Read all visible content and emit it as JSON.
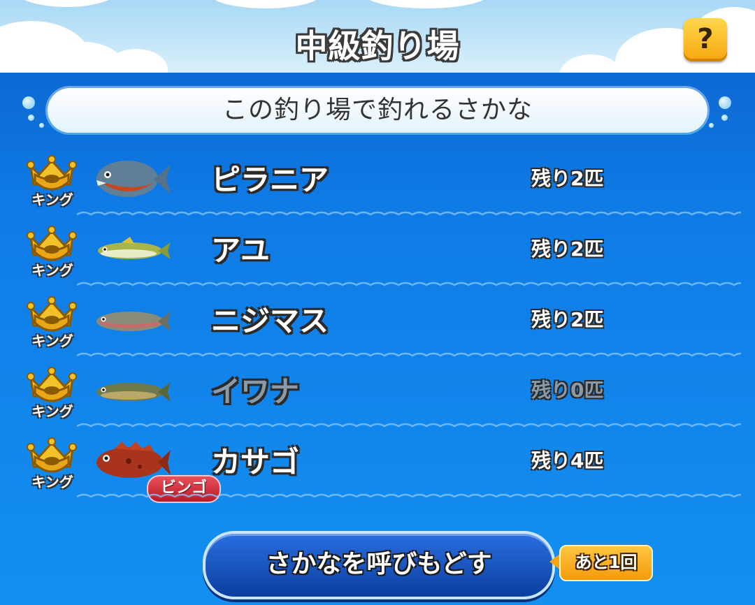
{
  "header": {
    "title": "中級釣り場",
    "help_label": "?"
  },
  "banner": {
    "text": "この釣り場で釣れるさかな"
  },
  "fish_list": [
    {
      "rank": "キング",
      "name": "ピラニア",
      "remaining": "残り2匹",
      "available": true,
      "bingo": ""
    },
    {
      "rank": "キング",
      "name": "アユ",
      "remaining": "残り2匹",
      "available": true,
      "bingo": ""
    },
    {
      "rank": "キング",
      "name": "ニジマス",
      "remaining": "残り2匹",
      "available": true,
      "bingo": ""
    },
    {
      "rank": "キング",
      "name": "イワナ",
      "remaining": "残り0匹",
      "available": false,
      "bingo": ""
    },
    {
      "rank": "キング",
      "name": "カサゴ",
      "remaining": "残り4匹",
      "available": true,
      "bingo": "ビンゴ"
    }
  ],
  "actions": {
    "recall_label": "さかなを呼びもどす",
    "remaining_uses": "あと1回"
  },
  "colors": {
    "accent_orange": "#f6a60f",
    "bingo_red": "#c8242f",
    "panel_blue": "#0f7be6"
  }
}
